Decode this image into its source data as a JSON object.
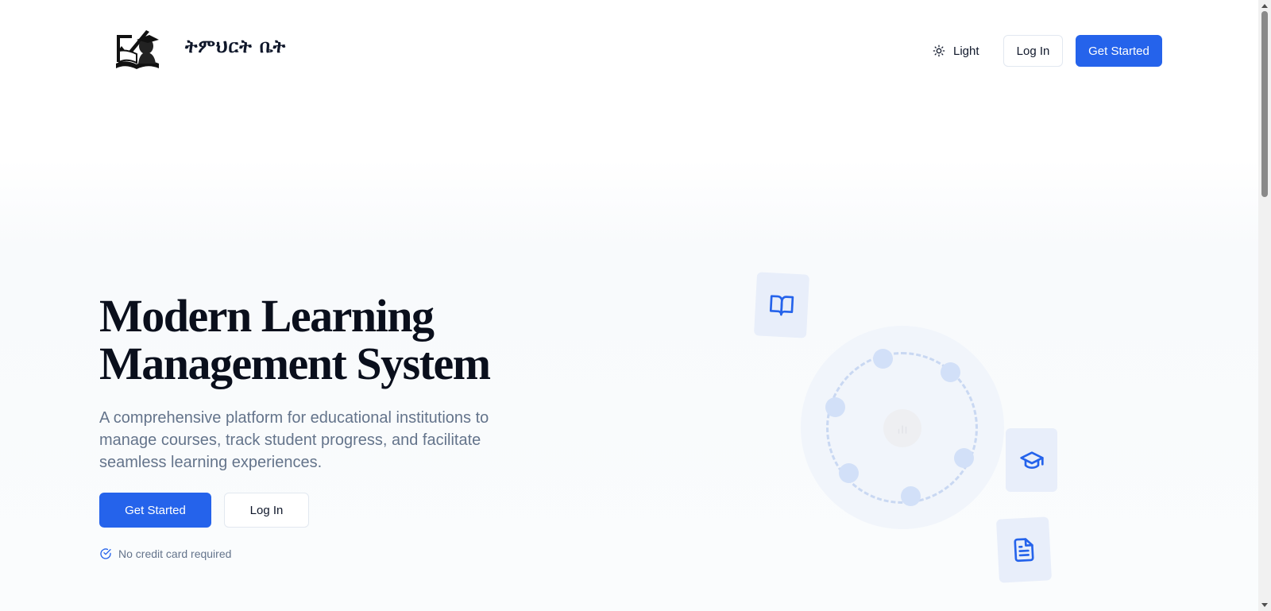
{
  "header": {
    "brand_name": "ትምህርት ቤት",
    "theme_label": "Light",
    "login_label": "Log In",
    "get_started_label": "Get Started"
  },
  "hero": {
    "title_line1": "Modern Learning",
    "title_line2": "Management System",
    "subtitle": "A comprehensive platform for educational institutions to manage courses, track student progress, and facilitate seamless learning experiences.",
    "get_started_label": "Get Started",
    "login_label": "Log In",
    "note": "No credit card required"
  },
  "illustration": {
    "icons": [
      "book-open-icon",
      "graduation-cap-icon",
      "file-text-icon",
      "bar-chart-icon"
    ]
  },
  "colors": {
    "primary": "#2563eb",
    "text": "#0f172a",
    "muted": "#64748b",
    "card_bg": "#e8eefa"
  }
}
